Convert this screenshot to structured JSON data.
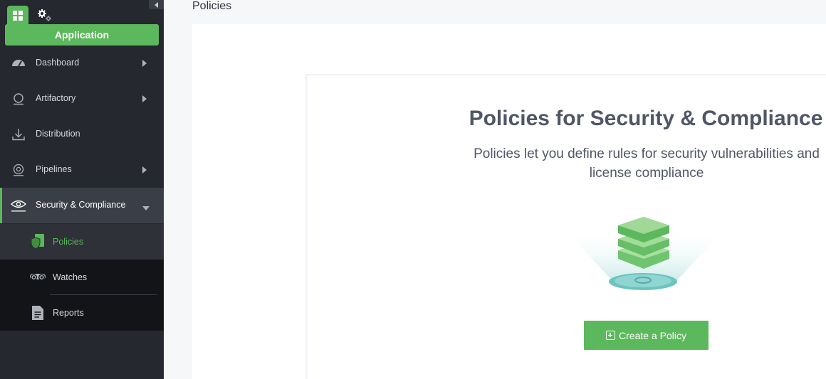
{
  "sidebar": {
    "app_button_label": "Application",
    "items": [
      {
        "label": "Dashboard",
        "icon": "dashboard-icon",
        "expandable": true
      },
      {
        "label": "Artifactory",
        "icon": "artifactory-icon",
        "expandable": true
      },
      {
        "label": "Distribution",
        "icon": "distribution-icon",
        "expandable": false
      },
      {
        "label": "Pipelines",
        "icon": "pipelines-icon",
        "expandable": true
      },
      {
        "label": "Security & Compliance",
        "icon": "eye-icon",
        "expandable": true,
        "expanded": true
      }
    ],
    "sub_items": [
      {
        "label": "Policies",
        "icon": "shield-icon",
        "selected": true
      },
      {
        "label": "Watches",
        "icon": "binoculars-icon",
        "selected": false
      },
      {
        "label": "Reports",
        "icon": "document-icon",
        "selected": false
      }
    ]
  },
  "main": {
    "page_title": "Policies",
    "card": {
      "title": "Policies for Security & Compliance",
      "subtitle": "Policies let you define rules for security vulnerabilities and license compliance",
      "create_button_label": "Create a Policy"
    }
  },
  "colors": {
    "accent": "#5cb85c",
    "sidebar_bg": "#25282e",
    "sidebar_active_bg": "#3a3e46",
    "sidebar_sub_bg": "#121417",
    "heading": "#4f5666"
  }
}
